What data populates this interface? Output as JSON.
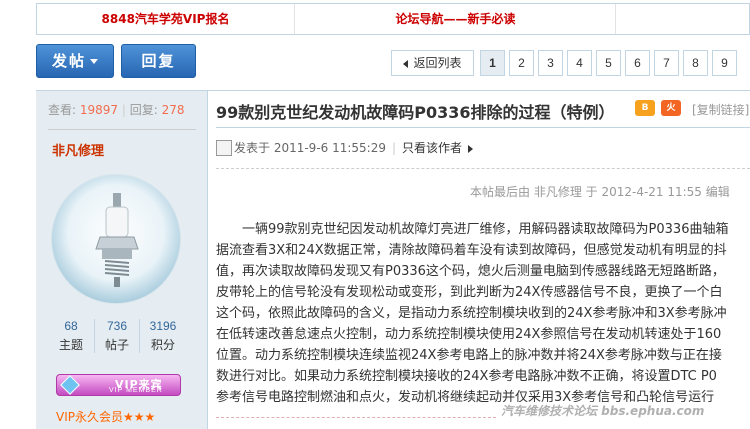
{
  "topbar": {
    "link1": "8848汽车学苑VIP报名",
    "link2": "论坛导航——新手必读"
  },
  "actions": {
    "post_label": "发帖",
    "reply_label": "回复"
  },
  "pager": {
    "back_label": "返回列表",
    "pages": [
      "1",
      "2",
      "3",
      "4",
      "5",
      "6",
      "7",
      "8",
      "9"
    ],
    "current": "1"
  },
  "sidebar": {
    "views_label": "查看:",
    "views": "19897",
    "replies_label": "回复:",
    "replies": "278",
    "author": "非凡修理",
    "stats": [
      {
        "value": "68",
        "label": "主题"
      },
      {
        "value": "736",
        "label": "帖子"
      },
      {
        "value": "3196",
        "label": "积分"
      }
    ],
    "vip_badge_cn": "VIP来宾",
    "vip_badge_en": "VIP MEMBER",
    "vip_level": "VIP永久会员★★★"
  },
  "post": {
    "title": "99款别克世纪发动机故障码P0336排除的过程（特例）",
    "icon_a": "B",
    "icon_b": "火",
    "copy_link": "[复制链接]",
    "posted_at": "发表于 2011-9-6 11:55:29",
    "only_author": "只看该作者",
    "edited_note": "本帖最后由 非凡修理 于 2012-4-21 11:55 编辑",
    "body_lines": [
      "　　一辆99款别克世纪因发动机故障灯亮进厂维修，用解码器读取故障码为P0336曲轴箱",
      "据流查看3X和24X数据正常，清除故障码着车没有读到故障码，但感觉发动机有明显的抖",
      "值，再次读取故障码发现又有P0336这个码，熄火后测量电脑到传感器线路无短路断路，",
      "皮带轮上的信号轮没有发现松动或变形，到此判断为24X传感器信号不良，更换了一个白",
      "这个码，依照此故障码的含义，是指动力系统控制模块收到的24X参考脉冲和3X参考脉冲",
      "在低转速改善怠速点火控制，动力系统控制模块使用24X参照信号在发动机转速处于160",
      "位置。动力系统控制模块连续监视24X参考电路上的脉冲数并将24X参考脉冲数与正在接",
      "数进行对比。如果动力系统控制模块接收的24X参考电路脉冲数不正确，将设置DTC P0",
      "参考信号电路控制燃油和点火，发动机将继续起动并仅采用3X参考信号和凸轮信号运行"
    ],
    "watermark": "汽车维修技术论坛 bbs.ephua.com"
  }
}
